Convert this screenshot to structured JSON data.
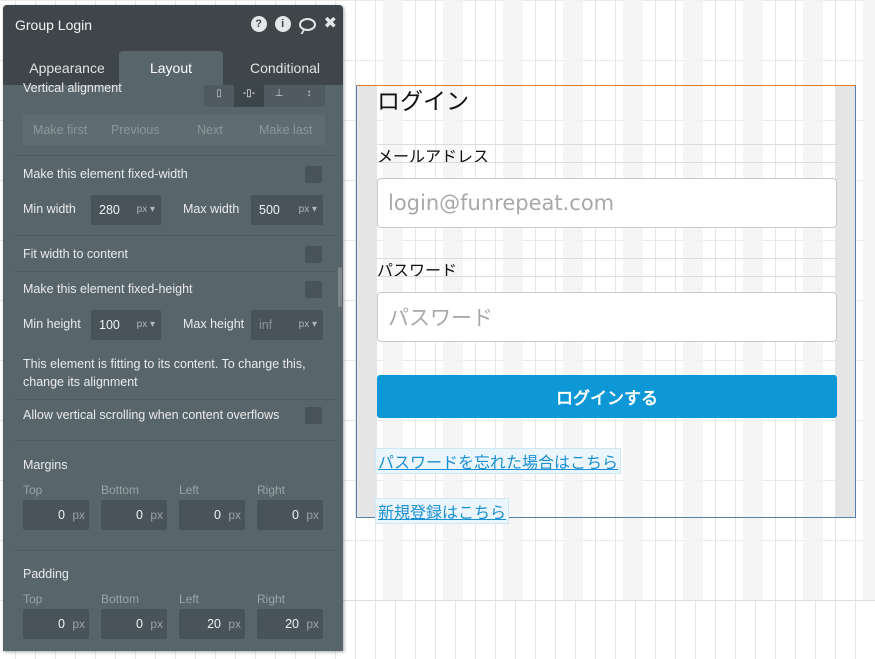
{
  "panel": {
    "title": "Group Login",
    "header_icons": [
      "help-icon",
      "info-icon",
      "comment-icon",
      "close-icon"
    ],
    "help_glyph": "?",
    "info_glyph": "i",
    "close_glyph": "✖",
    "tabs": [
      {
        "label": "Appearance",
        "active": false
      },
      {
        "label": "Layout",
        "active": true
      },
      {
        "label": "Conditional",
        "active": false
      }
    ],
    "vertical_alignment_label": "Vertical alignment",
    "nav": {
      "make_first": "Make first",
      "previous": "Previous",
      "next": "Next",
      "make_last": "Make last"
    },
    "fixed_width_label": "Make this element fixed-width",
    "min_width_label": "Min width",
    "min_width_value": "280",
    "max_width_label": "Max width",
    "max_width_value": "500",
    "unit_px": "px ▾",
    "fit_width_label": "Fit width to content",
    "fixed_height_label": "Make this element fixed-height",
    "min_height_label": "Min height",
    "min_height_value": "100",
    "max_height_label": "Max height",
    "max_height_placeholder": "inf",
    "fitting_note": "This element is fitting to its content. To change this, change its alignment",
    "vertical_scroll_label": "Allow vertical scrolling when content overflows",
    "margins": {
      "title": "Margins",
      "top_label": "Top",
      "bottom_label": "Bottom",
      "left_label": "Left",
      "right_label": "Right",
      "top": "0",
      "bottom": "0",
      "left": "0",
      "right": "0"
    },
    "padding": {
      "title": "Padding",
      "top_label": "Top",
      "bottom_label": "Bottom",
      "left_label": "Left",
      "right_label": "Right",
      "top": "0",
      "bottom": "0",
      "left": "20",
      "right": "20"
    },
    "box_unit": "px",
    "colors": {
      "panel_bg": "#58656a",
      "header_bg": "#3e4649",
      "field_bg": "#48545a"
    }
  },
  "login": {
    "title": "ログイン",
    "email_label": "メールアドレス",
    "email_placeholder": "login@funrepeat.com",
    "password_label": "パスワード",
    "password_placeholder": "パスワード",
    "submit_label": "ログインする",
    "forgot_link": "パスワードを忘れた場合はこちら",
    "signup_link": "新規登録はこちら",
    "colors": {
      "button": "#0d97d6",
      "link": "#1b8fd3"
    }
  }
}
